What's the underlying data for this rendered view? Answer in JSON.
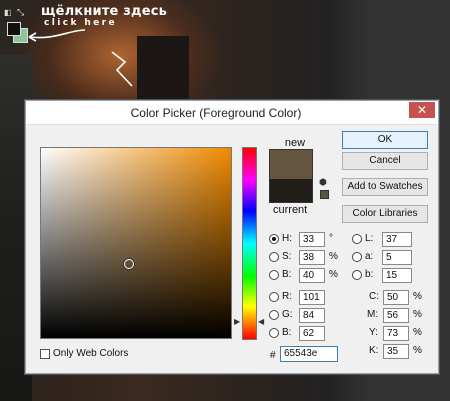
{
  "overlay": {
    "hint_main": "щёлкните здесь",
    "hint_sub": "click here",
    "swap_glyph": "⤡",
    "mini_glyph": "◧",
    "fg_color": "#111111",
    "bg_color": "#8ac69a"
  },
  "dialog": {
    "title": "Color Picker (Foreground Color)",
    "close_glyph": "✕",
    "label_new": "new",
    "label_current": "current",
    "new_color": "#65543e",
    "current_color": "#211d19",
    "cube_glyph": "⬢",
    "buttons": {
      "ok": "OK",
      "cancel": "Cancel",
      "add_to_swatches": "Add to Swatches",
      "color_libraries": "Color Libraries"
    },
    "hsb": {
      "h_label": "H:",
      "h_value": "33",
      "h_unit": "°",
      "s_label": "S:",
      "s_value": "38",
      "s_unit": "%",
      "b_label": "B:",
      "b_value": "40",
      "b_unit": "%"
    },
    "rgb": {
      "r_label": "R:",
      "r_value": "101",
      "g_label": "G:",
      "g_value": "84",
      "b_label": "B:",
      "b_value": "62"
    },
    "lab": {
      "l_label": "L:",
      "l_value": "37",
      "a_label": "a:",
      "a_value": "5",
      "b_label": "b:",
      "b_value": "15"
    },
    "cmyk": {
      "c_label": "C:",
      "c_value": "50",
      "c_unit": "%",
      "m_label": "M:",
      "m_value": "56",
      "m_unit": "%",
      "y_label": "Y:",
      "y_value": "73",
      "y_unit": "%",
      "k_label": "K:",
      "k_value": "35",
      "k_unit": "%"
    },
    "hex_label": "#",
    "hex_value": "65543e",
    "only_web_colors": "Only Web Colors",
    "triangle_left": "▶",
    "triangle_right": "◀"
  }
}
